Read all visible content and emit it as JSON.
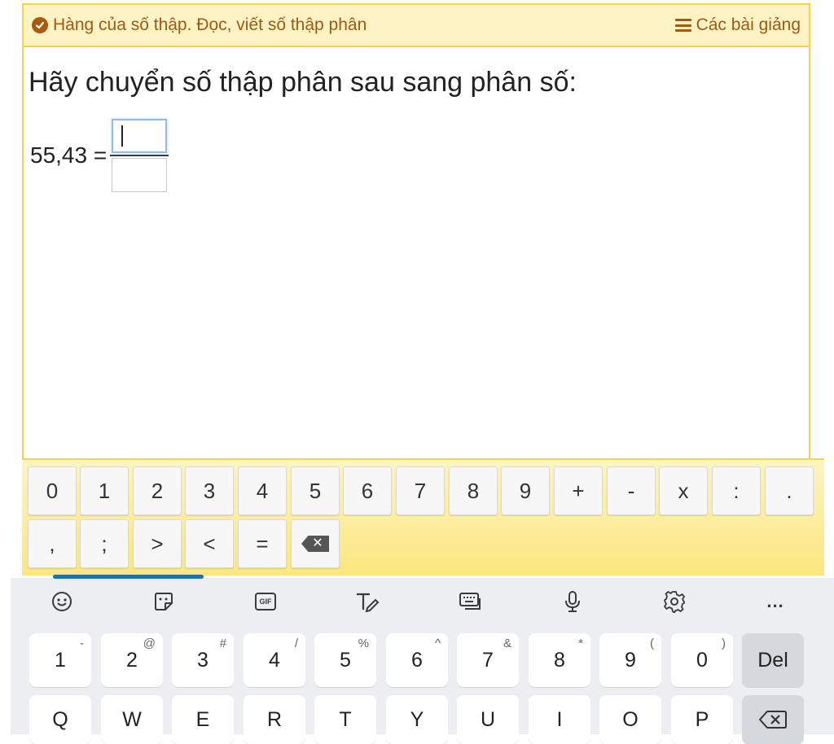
{
  "header": {
    "lesson_title": "Hàng của số thập. Đọc, viết số thập phân",
    "lessons_link": "Các bài giảng"
  },
  "question": {
    "prompt": "Hãy chuyển số thập phân sau sang phân số:",
    "lhs": "55,43 ="
  },
  "math_pad": {
    "row1": [
      "0",
      "1",
      "2",
      "3",
      "4",
      "5",
      "6",
      "7",
      "8",
      "9",
      "+",
      "-",
      "x",
      ":",
      "."
    ],
    "row2": [
      ",",
      ";",
      ">",
      "<",
      "="
    ]
  },
  "keyboard": {
    "toolbar": [
      "emoji-icon",
      "sticker-icon",
      "gif-icon",
      "handwriting-icon",
      "keyboard-layout-icon",
      "mic-icon",
      "gear-icon",
      "more-icon"
    ],
    "gif_label": "GIF",
    "more_label": "...",
    "number_row": [
      {
        "key": "1",
        "alt": "-"
      },
      {
        "key": "2",
        "alt": "@"
      },
      {
        "key": "3",
        "alt": "#"
      },
      {
        "key": "4",
        "alt": "/"
      },
      {
        "key": "5",
        "alt": "%"
      },
      {
        "key": "6",
        "alt": "^"
      },
      {
        "key": "7",
        "alt": "&"
      },
      {
        "key": "8",
        "alt": "*"
      },
      {
        "key": "9",
        "alt": "("
      },
      {
        "key": "0",
        "alt": ")"
      }
    ],
    "del_label": "Del",
    "letter_row": [
      "Q",
      "W",
      "E",
      "R",
      "T",
      "Y",
      "U",
      "I",
      "O",
      "P"
    ]
  },
  "colors": {
    "accent_border": "#f3d44a",
    "header_bg": "#fdf3c4",
    "header_text": "#a0590e"
  }
}
